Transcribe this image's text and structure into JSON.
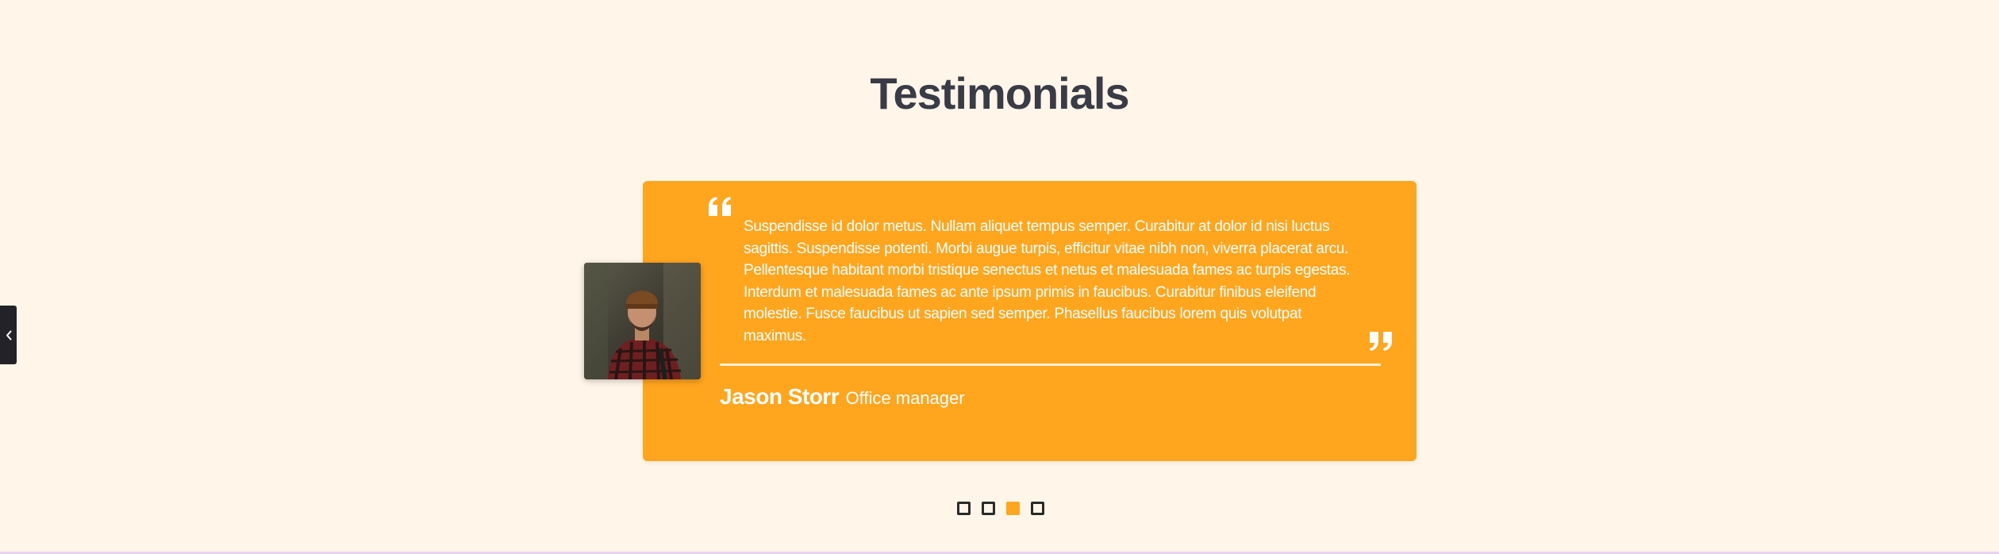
{
  "section": {
    "title": "Testimonials"
  },
  "colors": {
    "background": "#fff5e8",
    "card": "#ffa51e",
    "title": "#393c46",
    "dot_inactive": "#2a2a2a",
    "dot_active": "#ffa51e"
  },
  "carousel": {
    "prev_icon": "chevron-left-icon",
    "slide_count": 4,
    "active_index": 2
  },
  "testimonial": {
    "quote": "Suspendisse id dolor metus. Nullam aliquet tempus semper. Curabitur at dolor id nisi luctus sagittis. Suspendisse potenti. Morbi augue turpis, efficitur vitae nibh non, viverra placerat arcu. Pellentesque habitant morbi tristique senectus et netus et malesuada fames ac turpis egestas. Interdum et malesuada fames ac ante ipsum primis in faucibus. Curabitur finibus eleifend molestie. Fusce faucibus ut sapien sed semper. Phasellus faucibus lorem quis volutpat maximus.",
    "author_name": "Jason Storr",
    "author_role": "Office manager",
    "open_quote_icon": "quote-open-icon",
    "close_quote_icon": "quote-close-icon"
  }
}
